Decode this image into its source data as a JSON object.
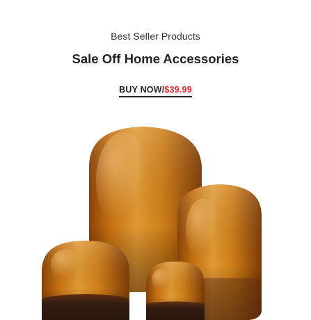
{
  "banner": {
    "subtitle": "Best Seller Products",
    "title": "Sale Off Home Accessories",
    "cta": {
      "label": "BUY NOW",
      "separator": "/",
      "price": "$39.99"
    }
  },
  "colors": {
    "text": "#222222",
    "price": "#e8252b",
    "glass_amber": "#c8740f",
    "glass_dark": "#3a2114"
  },
  "image": {
    "subject": "amber-glass-vases"
  }
}
